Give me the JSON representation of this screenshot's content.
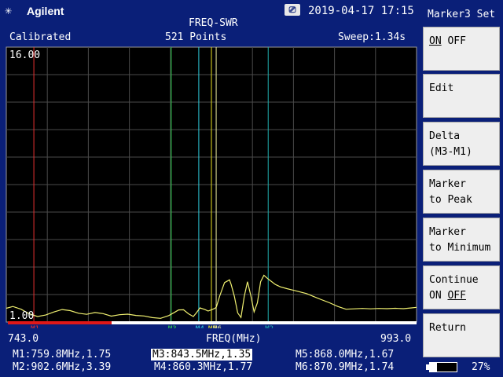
{
  "header": {
    "brand": "Agilent",
    "brand_icon": "asterisk-logo-icon",
    "datetime": "2019-04-17 17:15",
    "measurement": "FREQ-SWR",
    "status": "Calibrated",
    "points": "521 Points",
    "sweep": "Sweep:1.34s"
  },
  "softkeys": {
    "title": "Marker3 Set",
    "items": [
      {
        "line1": "ON",
        "line2": "OFF",
        "label": "ON OFF"
      },
      {
        "line1": "Edit",
        "line2": ""
      },
      {
        "line1": "Delta",
        "line2": "(M3-M1)"
      },
      {
        "line1": "Marker",
        "line2": "to Peak"
      },
      {
        "line1": "Marker",
        "line2": "to Minimum"
      },
      {
        "line1": "Continue",
        "line2_on": "ON",
        "line2_off": "OFF"
      },
      {
        "line1": "Return",
        "line2": ""
      }
    ]
  },
  "battery": {
    "percent_label": "27%",
    "level": 0.27
  },
  "footer": {
    "start_freq": "743.0",
    "axis_label": "FREQ(MHz)",
    "stop_freq": "993.0",
    "readouts": {
      "m1": "M1:759.8MHz,1.75",
      "m2": "M2:902.6MHz,3.39",
      "m3": "M3:843.5MHz,1.35",
      "m4": "M4:860.3MHz,1.77",
      "m5": "M5:868.0MHz,1.67",
      "m6": "M6:870.9MHz,1.74"
    }
  },
  "chart_data": {
    "type": "line",
    "xlabel": "FREQ(MHz)",
    "xlim": [
      743.0,
      993.0
    ],
    "ylim": [
      1.0,
      16.0
    ],
    "y_top_label": "16.00",
    "y_bottom_label": "1.00",
    "grid": true,
    "colors": {
      "trace": "#f0f070",
      "grid": "#4a4a4a",
      "background": "#000000"
    },
    "series": [
      {
        "x": [
          743,
          747,
          752,
          757,
          762,
          767,
          772,
          777,
          782,
          787,
          792,
          797,
          802,
          807,
          812,
          817,
          822,
          827,
          832,
          837,
          842,
          845,
          848,
          851,
          854,
          857,
          859,
          861,
          864,
          866,
          868,
          870,
          871,
          873,
          876,
          879,
          880,
          882,
          884,
          886,
          888,
          890,
          892,
          894,
          896,
          898,
          900,
          902,
          904,
          907,
          910,
          914,
          918,
          922,
          926,
          930,
          935,
          940,
          945,
          950,
          955,
          960,
          965,
          970,
          975,
          980,
          985,
          990,
          993
        ],
        "y": [
          1.75,
          1.85,
          1.7,
          1.45,
          1.3,
          1.38,
          1.55,
          1.68,
          1.62,
          1.48,
          1.42,
          1.52,
          1.46,
          1.32,
          1.4,
          1.43,
          1.36,
          1.33,
          1.24,
          1.2,
          1.35,
          1.5,
          1.66,
          1.67,
          1.45,
          1.3,
          1.52,
          1.77,
          1.68,
          1.6,
          1.67,
          1.74,
          1.82,
          2.4,
          3.15,
          3.3,
          3.05,
          2.4,
          1.5,
          1.25,
          2.4,
          3.2,
          2.45,
          1.55,
          2.05,
          3.2,
          3.55,
          3.39,
          3.25,
          3.05,
          2.92,
          2.82,
          2.73,
          2.64,
          2.55,
          2.4,
          2.22,
          2.05,
          1.85,
          1.7,
          1.72,
          1.74,
          1.72,
          1.74,
          1.73,
          1.75,
          1.73,
          1.77,
          1.8
        ]
      }
    ],
    "markers": [
      {
        "label": "M1",
        "freq": 759.8,
        "swr": 1.75,
        "color": "#e83030"
      },
      {
        "label": "M2",
        "freq": 902.6,
        "swr": 3.39,
        "color": "#20b0b0"
      },
      {
        "label": "M3",
        "freq": 843.5,
        "swr": 1.35,
        "color": "#30d050"
      },
      {
        "label": "M4",
        "freq": 860.3,
        "swr": 1.77,
        "color": "#30d0e0"
      },
      {
        "label": "M5",
        "freq": 868.0,
        "swr": 1.67,
        "color": "#e8e020"
      },
      {
        "label": "M6",
        "freq": 870.9,
        "swr": 1.74,
        "color": "#f0f0a0"
      }
    ]
  }
}
